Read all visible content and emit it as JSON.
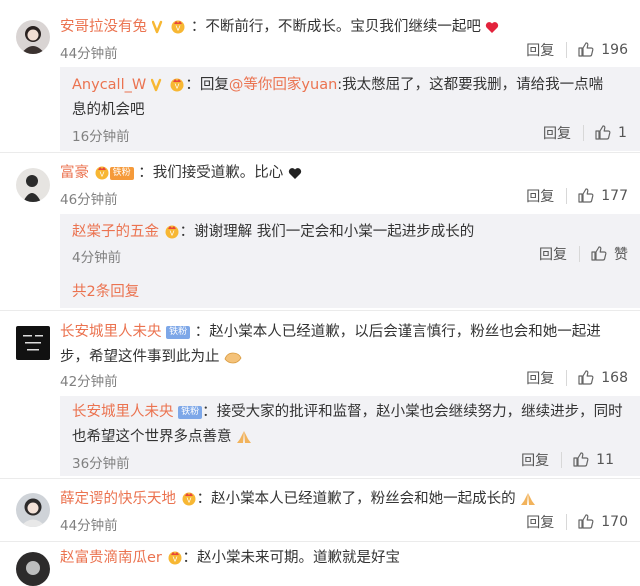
{
  "labels": {
    "reply": "回复",
    "like": "赞"
  },
  "colors": {
    "name": "#eb7350",
    "subbox_bg": "#f2f2f5"
  },
  "comments": [
    {
      "name": "安哥拉没有兔",
      "text": "：不断前行，不断成长。宝贝我们继续一起吧",
      "time": "44分钟前",
      "likes": "196",
      "reply": {
        "name": "Anycall_W",
        "prefix": "：回复",
        "mention": "@等你回家yuan",
        "text": ":我太憋屈了，这都要我删，请给我一点喘息的机会吧",
        "time": "16分钟前",
        "likes": "1"
      }
    },
    {
      "name": "富豪",
      "badge": "铁粉",
      "text": "：我们接受道歉。比心",
      "time": "46分钟前",
      "likes": "177",
      "reply": {
        "name": "赵棠子的五金",
        "text": "：谢谢理解 我们一定会和小棠一起进步成长的",
        "time": "4分钟前",
        "likes": "赞"
      },
      "more": "共2条回复"
    },
    {
      "name": "长安城里人未央",
      "badge": "铁粉",
      "text": "：赵小棠本人已经道歉，以后会谨言慎行，粉丝也会和她一起进步，希望这件事到此为止",
      "time": "42分钟前",
      "likes": "168",
      "reply": {
        "name": "长安城里人未央",
        "badge": "铁粉",
        "text": "：接受大家的批评和监督，赵小棠也会继续努力，继续进步，同时也希望这个世界多点善意",
        "time": "36分钟前",
        "likes": "11"
      }
    },
    {
      "name": "薛定谔的快乐天地",
      "text": "：赵小棠本人已经道歉了，粉丝会和她一起成长的",
      "time": "44分钟前",
      "likes": "170"
    },
    {
      "name": "赵富贵滴南瓜er",
      "text": "：赵小棠未来可期。道歉就是好宝"
    }
  ]
}
